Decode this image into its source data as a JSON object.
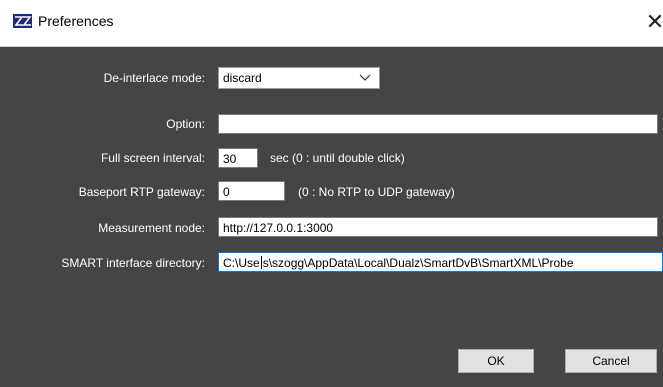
{
  "window": {
    "title": "Preferences",
    "close_glyph": "✕"
  },
  "form": {
    "deinterlace": {
      "label": "De-interlace mode:",
      "value": "discard"
    },
    "option": {
      "label": "Option:",
      "value": ""
    },
    "fullscreen": {
      "label": "Full screen interval:",
      "value": "30",
      "note": "sec (0 : until double click)"
    },
    "baseport": {
      "label": "Baseport RTP gateway:",
      "value": "0",
      "note": "(0 : No RTP to UDP gateway)"
    },
    "measurement": {
      "label": "Measurement node:",
      "value": "http://127.0.0.1:3000"
    },
    "smart": {
      "label": "SMART interface directory:",
      "value_before_caret": "C:\\Use",
      "value_after_caret": "s\\szogg\\AppData\\Local\\Dualz\\SmartDvB\\SmartXML\\Probe"
    }
  },
  "buttons": {
    "ok": "OK",
    "cancel": "Cancel"
  },
  "icons": {
    "app": "app-logo-icon",
    "close": "close-icon",
    "dropdown": "chevron-down-icon"
  },
  "colors": {
    "dialog_bg": "#454545",
    "label_text": "#ffffff",
    "focus_border": "#0078d7"
  }
}
